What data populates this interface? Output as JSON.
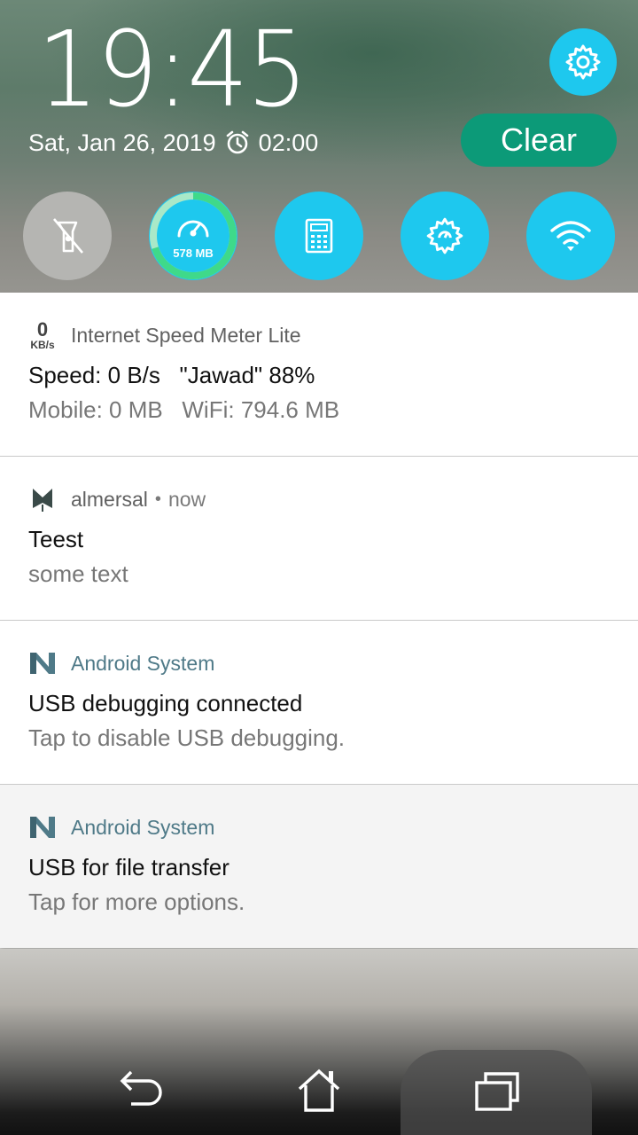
{
  "status": {
    "time": "19:45",
    "date": "Sat, Jan 26, 2019",
    "alarm_time": "02:00"
  },
  "header": {
    "clear_label": "Clear",
    "settings_icon": "gear-icon"
  },
  "quick_settings": [
    {
      "name": "flashlight",
      "icon": "flashlight-off-icon",
      "state": "off"
    },
    {
      "name": "memory-boost",
      "icon": "speedometer-icon",
      "label": "578 MB",
      "level": 0.7
    },
    {
      "name": "calculator",
      "icon": "calculator-icon",
      "state": "on"
    },
    {
      "name": "settings-tile",
      "icon": "settings-cog-icon",
      "state": "on"
    },
    {
      "name": "wifi",
      "icon": "wifi-icon",
      "state": "on"
    }
  ],
  "notifications": [
    {
      "icon_value": "0",
      "icon_unit": "KB/s",
      "app": "Internet Speed Meter Lite",
      "title": "Speed: 0 B/s   \"Jawad\" 88%",
      "body": "Mobile: 0 MB   WiFi: 794.6 MB"
    },
    {
      "app": "almersal",
      "separator": "•",
      "time": "now",
      "title": "Teest",
      "body": "some text"
    },
    {
      "app": "Android System",
      "title": "USB debugging connected",
      "body": "Tap to disable USB debugging."
    },
    {
      "app": "Android System",
      "title": "USB for file transfer",
      "body": "Tap for more options."
    }
  ],
  "colors": {
    "accent": "#1ec8ee",
    "clear_button": "#0c9a78",
    "system_app_name": "#4f7a88"
  }
}
